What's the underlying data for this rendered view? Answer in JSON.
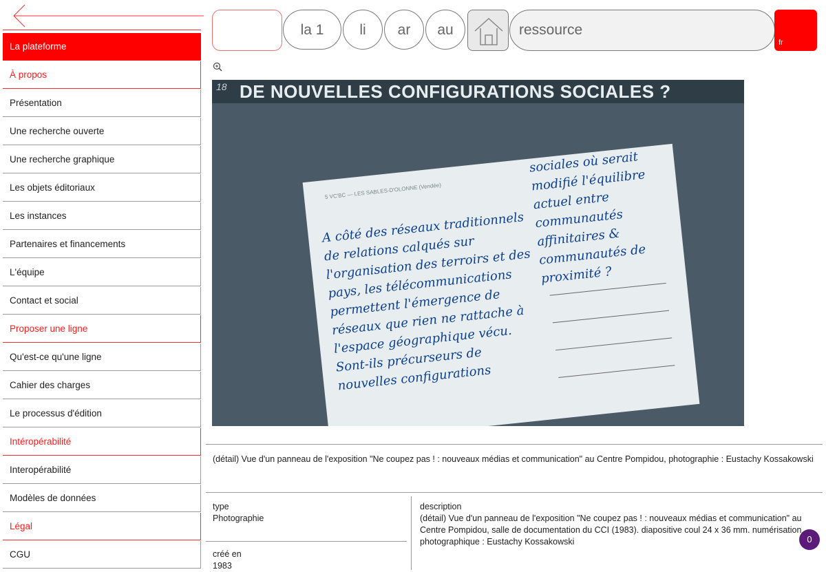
{
  "sidebar": {
    "items": [
      {
        "label": "La plateforme",
        "kind": "active"
      },
      {
        "label": "À propos",
        "kind": "section"
      },
      {
        "label": "Présentation",
        "kind": "item"
      },
      {
        "label": "Une recherche ouverte",
        "kind": "item"
      },
      {
        "label": "Une recherche graphique",
        "kind": "item"
      },
      {
        "label": "Les objets éditoriaux",
        "kind": "item"
      },
      {
        "label": "Les instances",
        "kind": "item"
      },
      {
        "label": "Partenaires et financements",
        "kind": "item"
      },
      {
        "label": "L'équipe",
        "kind": "item"
      },
      {
        "label": "Contact et social",
        "kind": "item"
      },
      {
        "label": "Proposer une ligne",
        "kind": "section"
      },
      {
        "label": "Qu'est-ce qu'une ligne",
        "kind": "item"
      },
      {
        "label": "Cahier des charges",
        "kind": "item"
      },
      {
        "label": "Le processus d'édition",
        "kind": "item"
      },
      {
        "label": "Intéropérabilité",
        "kind": "section"
      },
      {
        "label": "Interopérabilité",
        "kind": "item"
      },
      {
        "label": "Modèles de données",
        "kind": "item"
      },
      {
        "label": "Légal",
        "kind": "section"
      },
      {
        "label": "CGU",
        "kind": "item"
      }
    ]
  },
  "topbar": {
    "pills": [
      "la 1",
      "li",
      "ar",
      "au"
    ],
    "search_placeholder": "ressource",
    "lang": "fr"
  },
  "photo": {
    "number": "18",
    "headline": "DE NOUVELLES CONFIGURATIONS SOCIALES ?",
    "postcard_header": "5 VC'BC — LES SABLES-D'OLONNE (Vendée)",
    "handwriting_left": "A côté des réseaux traditionnels de relations calqués sur l'organisation des terroirs et des pays, les télécommunications permettent l'émergence de réseaux que rien ne rattache à l'espace géographique vécu. Sont-ils précurseurs de nouvelles configurations",
    "handwriting_right": "sociales où serait modifié l'équilibre actuel entre communautés affinitaires & communautés de proximité ?"
  },
  "caption": "(détail) Vue d'un panneau de l'exposition \"Ne coupez pas ! : nouveaux médias et communication\" au Centre Pompidou, photographie : Eustachy Kossakowski",
  "metadata": {
    "type_label": "type",
    "type_value": "Photographie",
    "created_label": "créé en",
    "created_value": "1983",
    "description_label": "description",
    "description_value": "(détail) Vue d'un panneau de l'exposition \"Ne coupez pas ! : nouveaux médias et communication\" au Centre Pompidou, salle de documentation du CCI (1983). diapositive coul 24 x 36 mm. numérisation photographique : Eustachy Kossakowski"
  },
  "badge": "0",
  "colors": {
    "accent": "#ff0000",
    "badge": "#5c1b7a"
  }
}
